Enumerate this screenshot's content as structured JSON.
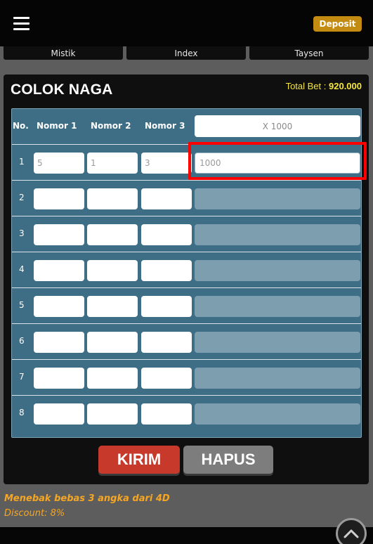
{
  "header": {
    "deposit_label": "Deposit",
    "menu_icon": "hamburger-icon"
  },
  "subnav": {
    "tabs": [
      "Mistik",
      "Index",
      "Taysen"
    ]
  },
  "game": {
    "title": "COLOK NAGA",
    "total_bet_label": "Total Bet :",
    "total_bet_value": "920.000"
  },
  "table": {
    "headers": [
      "No.",
      "Nomor 1",
      "Nomor 2",
      "Nomor 3"
    ],
    "multiplier_placeholder": "X 1000",
    "rows": [
      {
        "no": "1",
        "nomor1": "5",
        "nomor2": "1",
        "nomor3": "3",
        "amount": "1000"
      },
      {
        "no": "2",
        "nomor1": "",
        "nomor2": "",
        "nomor3": "",
        "amount": ""
      },
      {
        "no": "3",
        "nomor1": "",
        "nomor2": "",
        "nomor3": "",
        "amount": ""
      },
      {
        "no": "4",
        "nomor1": "",
        "nomor2": "",
        "nomor3": "",
        "amount": ""
      },
      {
        "no": "5",
        "nomor1": "",
        "nomor2": "",
        "nomor3": "",
        "amount": ""
      },
      {
        "no": "6",
        "nomor1": "",
        "nomor2": "",
        "nomor3": "",
        "amount": ""
      },
      {
        "no": "7",
        "nomor1": "",
        "nomor2": "",
        "nomor3": "",
        "amount": ""
      },
      {
        "no": "8",
        "nomor1": "",
        "nomor2": "",
        "nomor3": "",
        "amount": ""
      }
    ]
  },
  "actions": {
    "submit_label": "KIRIM",
    "clear_label": "HAPUS"
  },
  "info": {
    "description": "Menebak bebas 3 angka dari 4D",
    "discount": "Discount: 8%"
  },
  "colors": {
    "accent": "#c48b13",
    "submit": "#c7392b",
    "clear": "#7d7d7d",
    "table_bg": "#3d6e85",
    "highlight": "#ff0000",
    "bet_text": "#f5e63a",
    "info_text": "#f6a623"
  }
}
